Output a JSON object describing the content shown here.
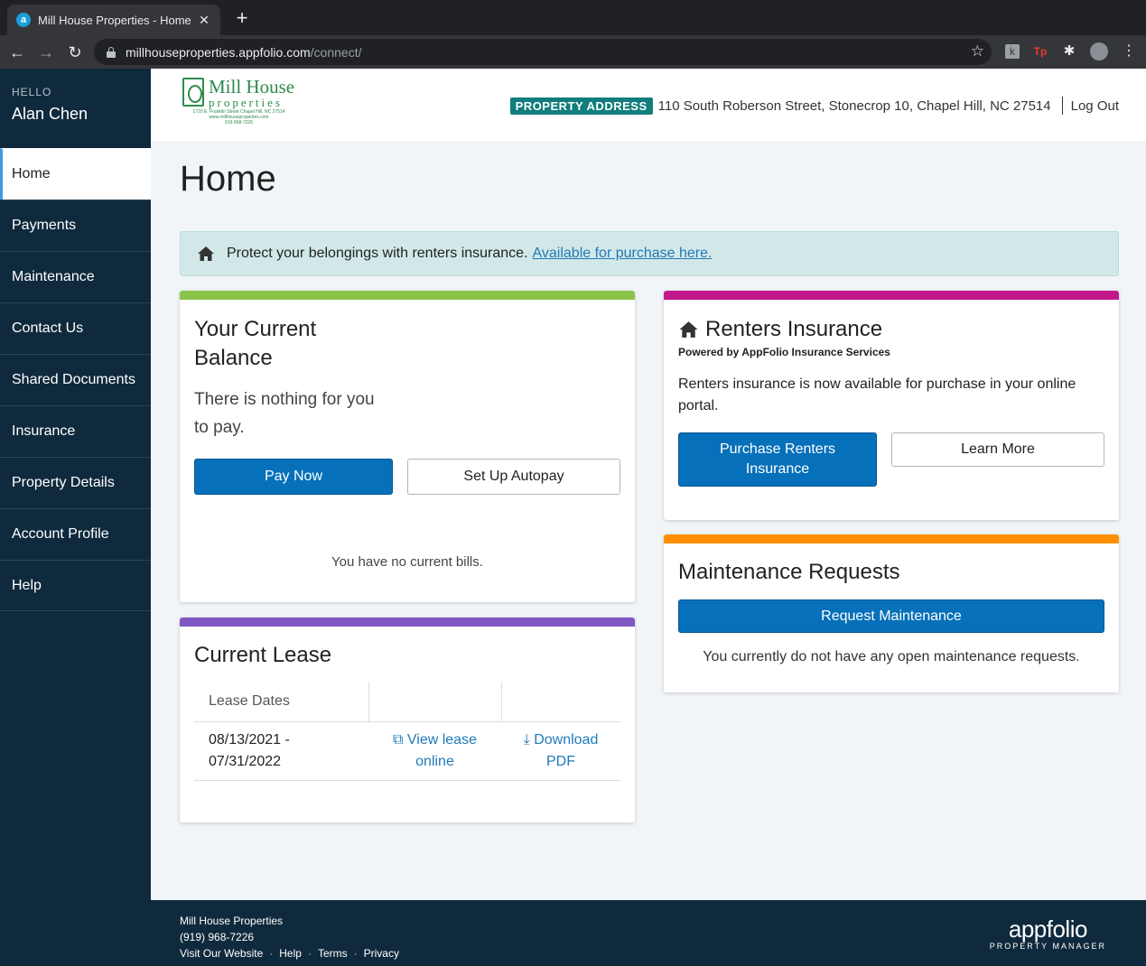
{
  "browser": {
    "tab_title": "Mill House Properties - Home",
    "favicon_letter": "a",
    "url_host": "millhouseproperties.appfolio.com",
    "url_path": "/connect/",
    "ext_k": "k",
    "ext_tp": "Tp"
  },
  "sidebar": {
    "hello_label": "HELLO",
    "user_name": "Alan Chen",
    "items": [
      {
        "label": "Home",
        "active": true
      },
      {
        "label": "Payments"
      },
      {
        "label": "Maintenance"
      },
      {
        "label": "Contact Us"
      },
      {
        "label": "Shared Documents"
      },
      {
        "label": "Insurance"
      },
      {
        "label": "Property Details"
      },
      {
        "label": "Account Profile"
      },
      {
        "label": "Help"
      }
    ]
  },
  "header": {
    "logo_name": "Mill House",
    "logo_sub": "properties",
    "logo_fine": "1720 E. Franklin Street Chapel Hill, NC 27514\nwww.millhouseproperties.com\n919-968-7226",
    "property_badge": "PROPERTY ADDRESS",
    "property_address": "110 South Roberson Street, Stonecrop 10, Chapel Hill, NC 27514",
    "logout": "Log Out"
  },
  "main": {
    "title": "Home",
    "alert_text": "Protect your belongings with renters insurance.",
    "alert_link": "Available for purchase here."
  },
  "balance": {
    "title_line1": "Your Current",
    "title_line2": "Balance",
    "message_line1": "There is nothing for you",
    "message_line2": "to pay.",
    "pay_now": "Pay Now",
    "autopay": "Set Up Autopay",
    "no_bills": "You have no current bills."
  },
  "lease": {
    "title": "Current Lease",
    "col_dates": "Lease Dates",
    "dates_line1": "08/13/2021 -",
    "dates_line2": "07/31/2022",
    "view_line1": "View lease",
    "view_line2": "online",
    "download_line1": "Download",
    "download_line2": "PDF"
  },
  "insurance": {
    "title": "Renters Insurance",
    "powered_by": "Powered by AppFolio Insurance Services",
    "description": "Renters insurance is now available for purchase in your online portal.",
    "purchase_line1": "Purchase Renters",
    "purchase_line2": "Insurance",
    "learn_more": "Learn More"
  },
  "maintenance": {
    "title": "Maintenance Requests",
    "request_button": "Request Maintenance",
    "empty_text": "You currently do not have any open maintenance requests."
  },
  "footer": {
    "company": "Mill House Properties",
    "phone": "(919) 968-7226",
    "links": [
      "Visit Our Website",
      "Help",
      "Terms",
      "Privacy"
    ],
    "logo_word": "appfolio",
    "logo_sub": "PROPERTY MANAGER"
  },
  "colors": {
    "sidebar_bg": "#102a3d",
    "primary": "#0670ba",
    "balance_bar": "#8bc34a",
    "lease_bar": "#7e57c2",
    "insurance_bar": "#c2188b",
    "maintenance_bar": "#ff8f00",
    "badge": "#127d7d"
  }
}
